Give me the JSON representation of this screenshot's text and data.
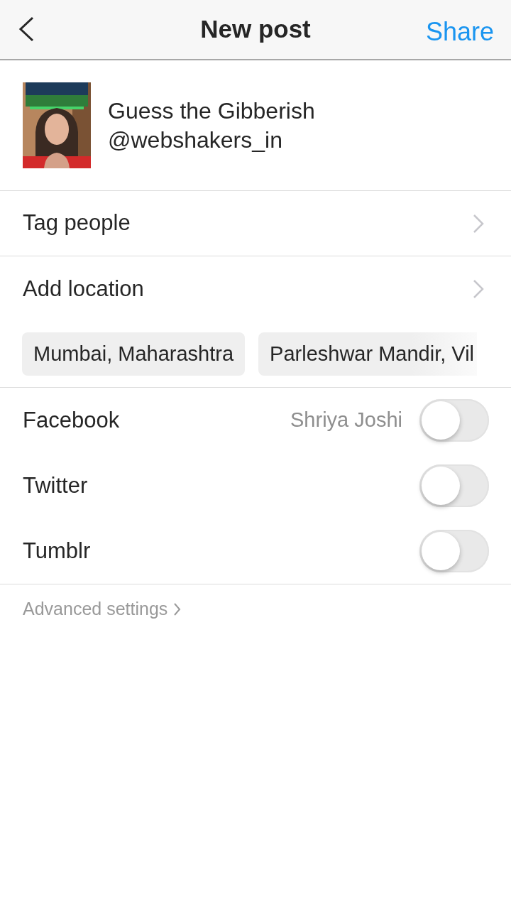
{
  "header": {
    "title": "New post",
    "action": "Share"
  },
  "post": {
    "caption": "Guess the Gibberish @webshakers_in"
  },
  "menu": [
    {
      "label": "Tag people"
    },
    {
      "label": "Add location"
    }
  ],
  "location_suggestions": [
    "Mumbai, Maharashtra",
    "Parleshwar Mandir, Vil"
  ],
  "share_to": [
    {
      "label": "Facebook",
      "account": "Shriya Joshi",
      "on": false
    },
    {
      "label": "Twitter",
      "on": false
    },
    {
      "label": "Tumblr",
      "on": false
    }
  ],
  "advanced_settings": "Advanced settings"
}
